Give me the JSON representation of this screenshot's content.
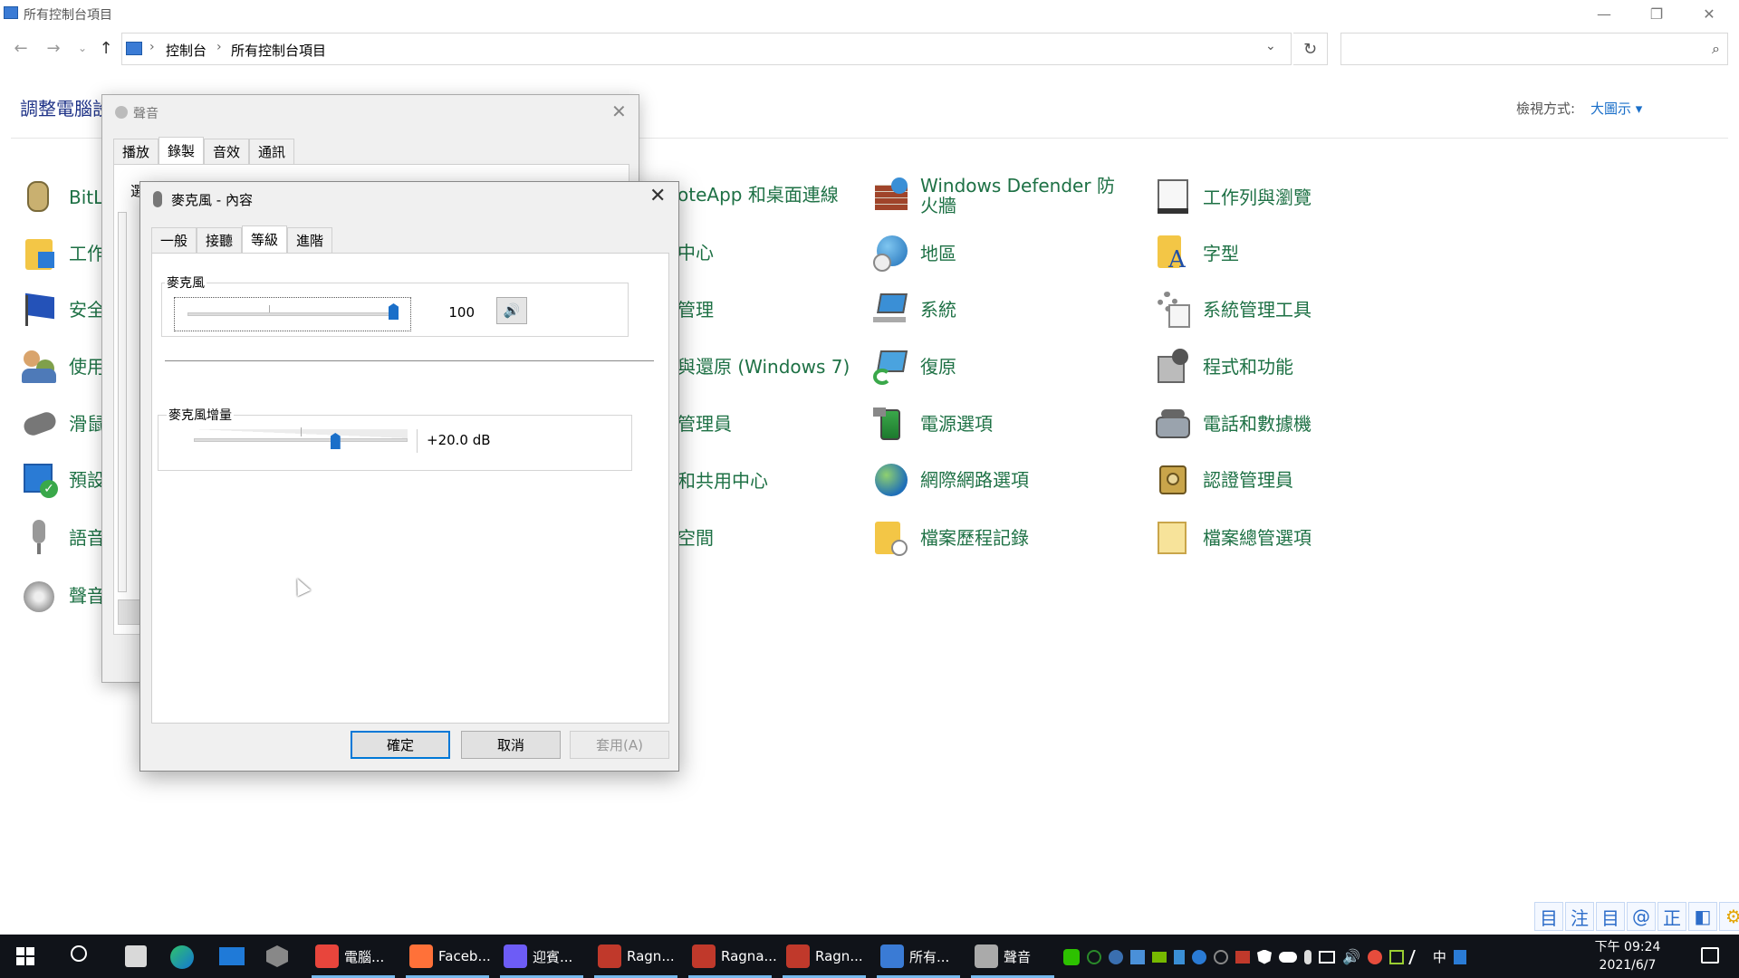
{
  "window": {
    "title": "所有控制台項目",
    "controls": {
      "minimize": "—",
      "restore": "❐",
      "close": "✕"
    }
  },
  "nav": {
    "back": "←",
    "forward": "→",
    "recent": "⌄",
    "up": "↑",
    "breadcrumb": [
      "控制台",
      "所有控制台項目"
    ],
    "separator": "›",
    "dropdown": "⌄",
    "refresh": "↻",
    "search_placeholder": "",
    "search_icon": "⌕"
  },
  "header": {
    "title": "調整電腦設定",
    "view_label": "檢視方式:",
    "view_value": "大圖示 ▾"
  },
  "items": {
    "col1": [
      "BitLocker 磁碟機加密",
      "工作資料夾",
      "安全性與維護",
      "使用者帳戶",
      "滑鼠",
      "預設程式",
      "語音辨識",
      "聲音"
    ],
    "col1_visible": [
      "BitL",
      "工作",
      "安全",
      "使用",
      "滑鼠",
      "預設",
      "語音",
      "聲音"
    ],
    "col2_visible": [
      "oteApp 和桌面連線",
      "中心",
      "管理",
      "與還原 (Windows 7)",
      "管理員",
      "和共用中心",
      "空間"
    ],
    "col3": [
      "Windows Defender 防火牆",
      "地區",
      "系統",
      "復原",
      "電源選項",
      "網際網路選項",
      "檔案歷程記錄"
    ],
    "col4": [
      "工作列與瀏覽",
      "字型",
      "系統管理工具",
      "程式和功能",
      "電話和數據機",
      "認證管理員",
      "檔案總管選項"
    ]
  },
  "sound_dialog": {
    "title": "聲音",
    "close": "✕",
    "tabs": [
      "播放",
      "錄製",
      "音效",
      "通訊"
    ],
    "active_tab": 1,
    "partial_text": "選"
  },
  "props_dialog": {
    "title": "麥克風 - 內容",
    "close": "✕",
    "tabs": [
      "一般",
      "接聽",
      "等級",
      "進階"
    ],
    "active_tab": 2,
    "mic_label": "麥克風",
    "mic_value": "100",
    "mic_level": 1.0,
    "mute_icon": "🔊",
    "boost_label": "麥克風增量",
    "boost_value": "+20.0 dB",
    "boost_level": 0.67,
    "ok": "確定",
    "cancel": "取消",
    "apply": "套用(A)"
  },
  "taskbar": {
    "apps": [
      {
        "label": "電腦...",
        "color": "#e8453c"
      },
      {
        "label": "Faceb...",
        "color": "#ff7139"
      },
      {
        "label": "迎賓...",
        "color": "#6d5cf6"
      },
      {
        "label": "Ragn...",
        "color": "#c0392b"
      },
      {
        "label": "Ragna...",
        "color": "#c0392b"
      },
      {
        "label": "Ragn...",
        "color": "#c0392b"
      },
      {
        "label": "所有...",
        "color": "#3a7bd5"
      },
      {
        "label": "聲音",
        "color": "#aaaaaa"
      }
    ],
    "ime_lang": "中",
    "time": "下午 09:24",
    "date": "2021/6/7",
    "ime_bar": [
      "目",
      "注",
      "目",
      "@",
      "正",
      "◧",
      "⚙"
    ]
  }
}
